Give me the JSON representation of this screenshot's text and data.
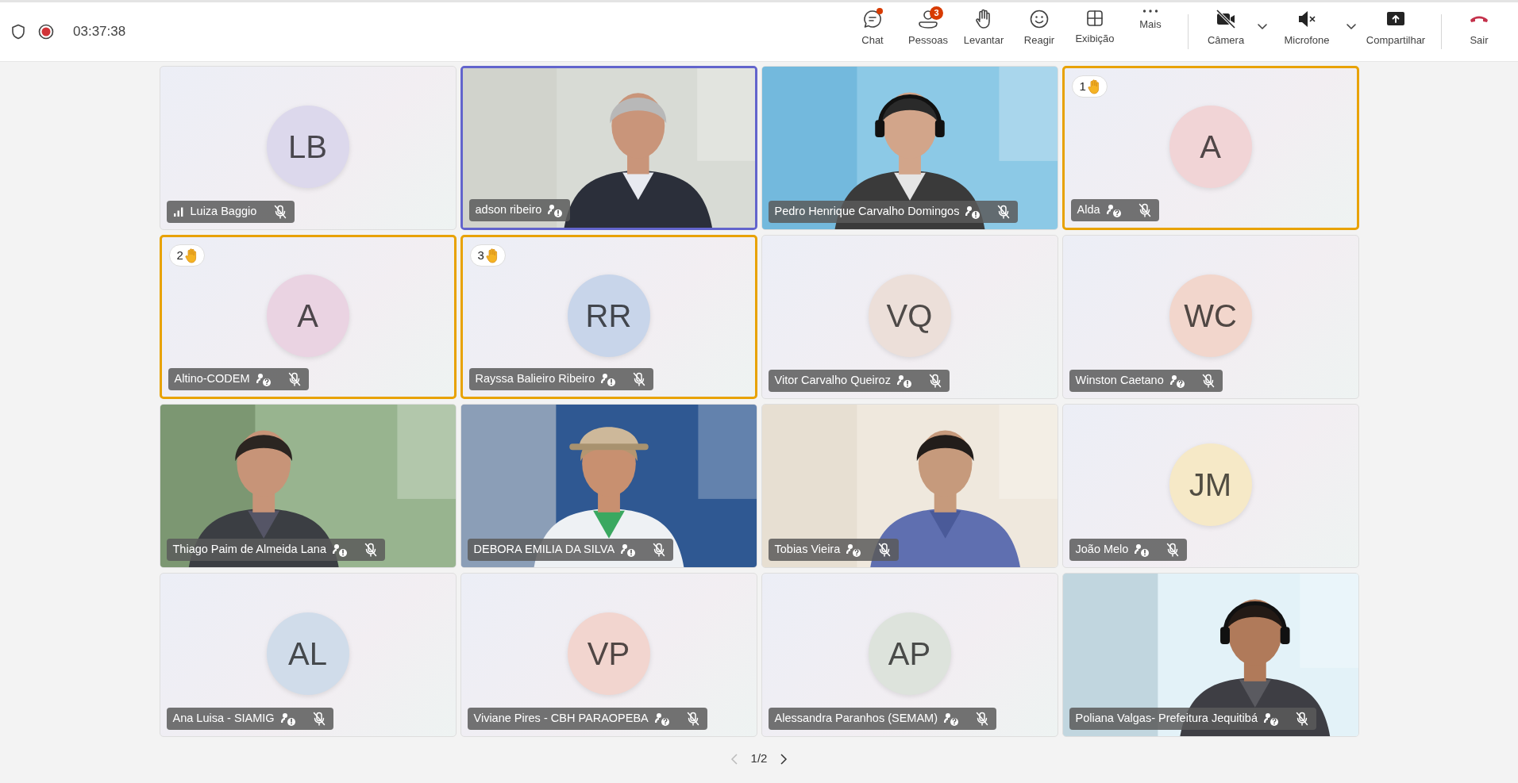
{
  "header": {
    "timer": "03:37:38",
    "recording": true
  },
  "toolbar": {
    "groups": [
      [
        {
          "kind": "chat",
          "label": "Chat",
          "dot": true
        },
        {
          "kind": "people",
          "label": "Pessoas",
          "count": "3"
        },
        {
          "kind": "hand",
          "label": "Levantar"
        },
        {
          "kind": "react",
          "label": "Reagir"
        },
        {
          "kind": "view",
          "label": "Exibição"
        },
        {
          "kind": "more",
          "label": "Mais"
        }
      ],
      [
        {
          "kind": "camera",
          "label": "Câmera",
          "off": true,
          "caret": true
        },
        {
          "kind": "mic",
          "label": "Microfone",
          "off": true,
          "caret": true
        },
        {
          "kind": "share",
          "label": "Compartilhar"
        }
      ],
      [
        {
          "kind": "leave",
          "label": "Sair"
        }
      ]
    ]
  },
  "tiles": [
    {
      "name": "Luiza Baggio",
      "kind": "avatar",
      "initials": "LB",
      "color": "#dcd8ec",
      "signal": true,
      "speaking": false,
      "hand_raised": false,
      "muted": true
    },
    {
      "name": "adson ribeiro",
      "kind": "video",
      "speaking": true,
      "hand_raised": false,
      "status_alert": true,
      "muted": false
    },
    {
      "name": "Pedro Henrique Carvalho Domingos",
      "kind": "video",
      "speaking": false,
      "hand_raised": false,
      "status_alert": true,
      "muted": true
    },
    {
      "name": "Alda",
      "kind": "avatar",
      "initials": "A",
      "color": "#f1d4d6",
      "speaking": false,
      "hand_raised": true,
      "hand": "1",
      "status_alert": false,
      "muted": true
    },
    {
      "name": "Altino-CODEM",
      "kind": "avatar",
      "initials": "A",
      "color": "#ead3e2",
      "speaking": false,
      "hand_raised": true,
      "hand": "2",
      "status_alert": false,
      "muted": true
    },
    {
      "name": "Rayssa Balieiro Ribeiro",
      "kind": "avatar",
      "initials": "RR",
      "color": "#c8d5ea",
      "speaking": false,
      "hand_raised": true,
      "hand": "3",
      "status_alert": true,
      "muted": true
    },
    {
      "name": "Vitor Carvalho Queiroz",
      "kind": "avatar",
      "initials": "VQ",
      "color": "#ecdfd9",
      "speaking": false,
      "hand_raised": false,
      "status_alert": true,
      "muted": true
    },
    {
      "name": "Winston Caetano",
      "kind": "avatar",
      "initials": "WC",
      "color": "#f2d6cc",
      "speaking": false,
      "hand_raised": false,
      "status_alert": false,
      "muted": true
    },
    {
      "name": "Thiago Paim de Almeida Lana",
      "kind": "video",
      "speaking": false,
      "hand_raised": false,
      "status_alert": true,
      "muted": true
    },
    {
      "name": "DEBORA EMILIA DA SILVA",
      "kind": "video",
      "speaking": false,
      "hand_raised": false,
      "status_alert": true,
      "muted": true
    },
    {
      "name": "Tobias Vieira",
      "kind": "video",
      "speaking": false,
      "hand_raised": false,
      "status_alert": false,
      "muted": true
    },
    {
      "name": "João Melo",
      "kind": "avatar",
      "initials": "JM",
      "color": "#f6e9c7",
      "speaking": false,
      "hand_raised": false,
      "status_alert": true,
      "muted": true
    },
    {
      "name": "Ana Luisa - SIAMIG",
      "kind": "avatar",
      "initials": "AL",
      "color": "#d0dcea",
      "speaking": false,
      "hand_raised": false,
      "status_alert": true,
      "muted": true
    },
    {
      "name": "Viviane Pires - CBH PARAOPEBA",
      "kind": "avatar",
      "initials": "VP",
      "color": "#f2d5cf",
      "speaking": false,
      "hand_raised": false,
      "status_alert": false,
      "muted": true
    },
    {
      "name": "Alessandra Paranhos (SEMAM)",
      "kind": "avatar",
      "initials": "AP",
      "color": "#dde3dc",
      "speaking": false,
      "hand_raised": false,
      "status_alert": false,
      "muted": true
    },
    {
      "name": "Poliana Valgas- Prefeitura Jequitibá",
      "kind": "video",
      "speaking": false,
      "hand_raised": false,
      "status_alert": false,
      "muted": true
    }
  ],
  "pager": {
    "text": "1/2",
    "prev_disabled": true,
    "next_disabled": false
  }
}
